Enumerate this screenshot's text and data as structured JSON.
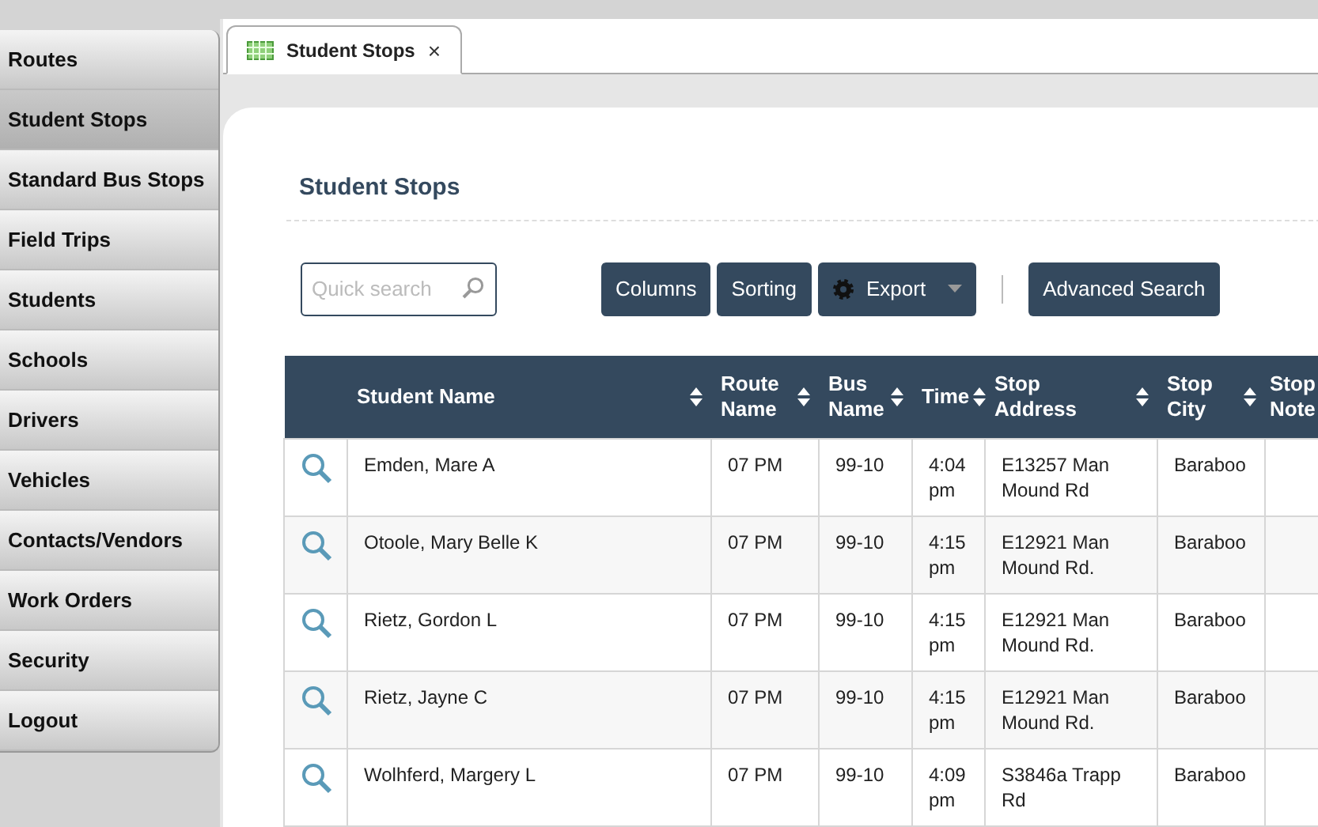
{
  "sidebar": {
    "items": [
      {
        "label": "Routes",
        "selected": false
      },
      {
        "label": "Student Stops",
        "selected": true
      },
      {
        "label": "Standard Bus Stops",
        "selected": false
      },
      {
        "label": "Field Trips",
        "selected": false
      },
      {
        "label": "Students",
        "selected": false
      },
      {
        "label": "Schools",
        "selected": false
      },
      {
        "label": "Drivers",
        "selected": false
      },
      {
        "label": "Vehicles",
        "selected": false
      },
      {
        "label": "Contacts/Vendors",
        "selected": false
      },
      {
        "label": "Work Orders",
        "selected": false
      },
      {
        "label": "Security",
        "selected": false
      },
      {
        "label": "Logout",
        "selected": false
      }
    ]
  },
  "tabs": [
    {
      "label": "Student Stops",
      "selected": true,
      "close": "×"
    }
  ],
  "page_title": "Student Stops",
  "search": {
    "placeholder": "Quick search"
  },
  "toolbar": [
    {
      "label": "Columns",
      "kind": "plain"
    },
    {
      "label": "Sorting",
      "kind": "plain"
    },
    {
      "label": "Export",
      "kind": "menu"
    },
    {
      "label": "Advanced Search",
      "kind": "separated"
    }
  ],
  "table": {
    "columns": [
      "Student Name",
      "Route Name",
      "Bus Name",
      "Time",
      "Stop Address",
      "Stop City",
      "Stop Note"
    ],
    "rows": [
      [
        "Emden, Mare A",
        "07 PM",
        "99-10",
        "4:04 pm",
        "E13257 Man Mound Rd",
        "Baraboo",
        ""
      ],
      [
        "Otoole, Mary Belle K",
        "07 PM",
        "99-10",
        "4:15 pm",
        "E12921 Man Mound Rd.",
        "Baraboo",
        ""
      ],
      [
        "Rietz, Gordon L",
        "07 PM",
        "99-10",
        "4:15 pm",
        "E12921 Man Mound Rd.",
        "Baraboo",
        ""
      ],
      [
        "Rietz, Jayne C",
        "07 PM",
        "99-10",
        "4:15 pm",
        "E12921 Man Mound Rd.",
        "Baraboo",
        ""
      ],
      [
        "Wolhferd, Margery L",
        "07 PM",
        "99-10",
        "4:09 pm",
        "S3846a Trapp Rd",
        "Baraboo",
        ""
      ]
    ]
  }
}
